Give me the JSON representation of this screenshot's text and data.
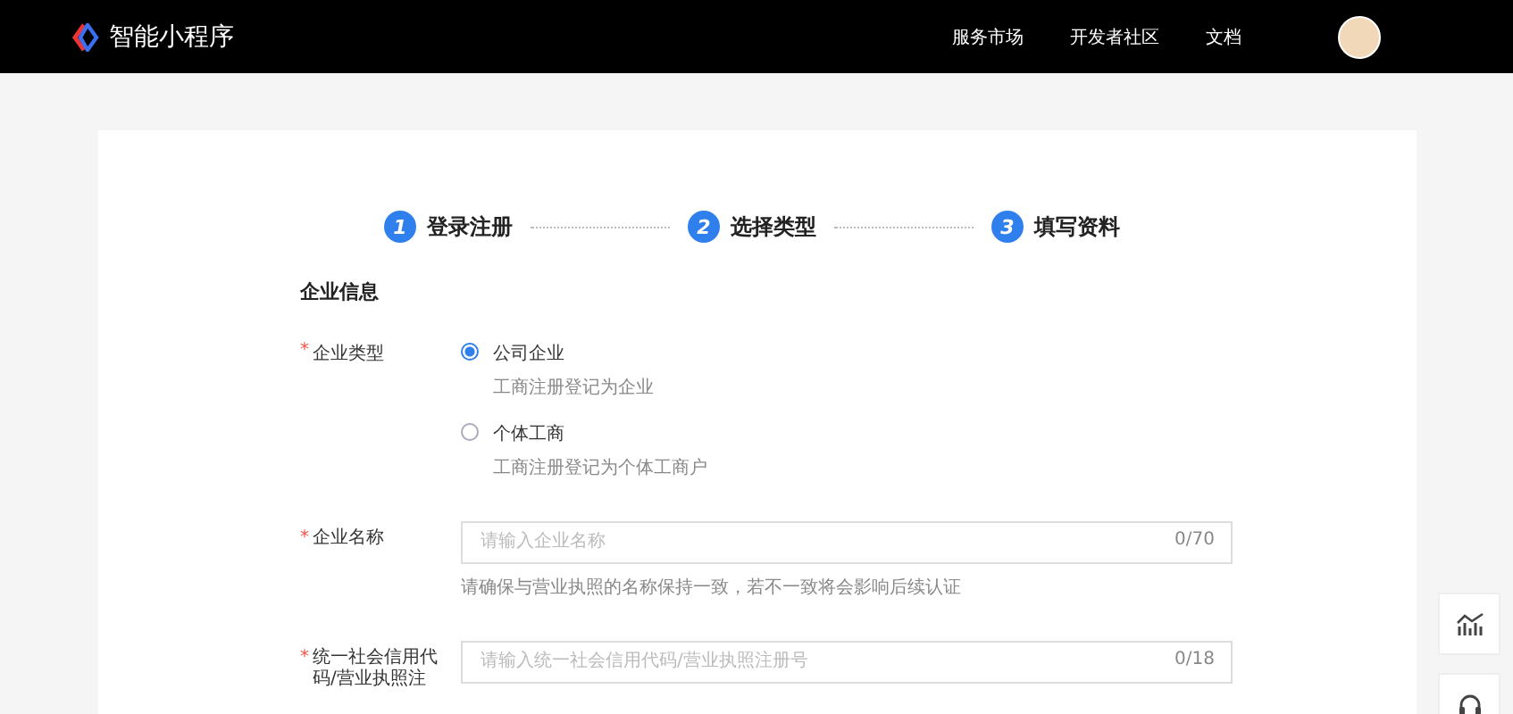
{
  "header": {
    "logo_text": "智能小程序",
    "nav": [
      {
        "label": "服务市场"
      },
      {
        "label": "开发者社区"
      },
      {
        "label": "文档"
      }
    ]
  },
  "steps": [
    {
      "number": "1",
      "label": "登录注册"
    },
    {
      "number": "2",
      "label": "选择类型"
    },
    {
      "number": "3",
      "label": "填写资料"
    }
  ],
  "section_title": "企业信息",
  "enterprise_type": {
    "label": "企业类型",
    "required_mark": "*",
    "options": [
      {
        "label": "公司企业",
        "description": "工商注册登记为企业",
        "selected": true
      },
      {
        "label": "个体工商",
        "description": "工商注册登记为个体工商户",
        "selected": false
      }
    ]
  },
  "fields": [
    {
      "label": "企业名称",
      "required_mark": "*",
      "placeholder": "请输入企业名称",
      "counter": "0/70",
      "hint": "请确保与营业执照的名称保持一致，若不一致将会影响后续认证"
    },
    {
      "label": "统一社会信用代码/营业执照注",
      "required_mark": "*",
      "placeholder": "请输入统一社会信用代码/营业执照注册号",
      "counter": "0/18"
    }
  ]
}
